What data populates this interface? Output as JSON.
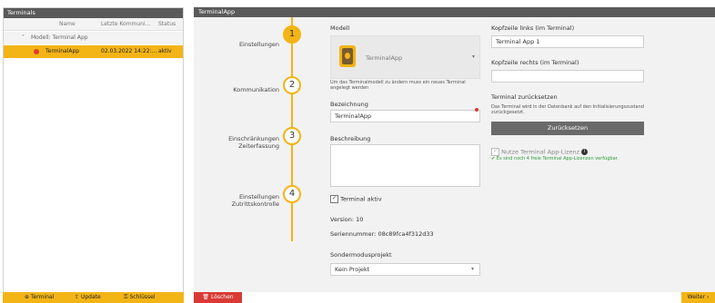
{
  "left_panel": {
    "title": "Terminals",
    "columns": {
      "name": "Name",
      "last_comm": "Letzte Kommuni...",
      "status": "Status"
    },
    "group": "Modell: Terminal App",
    "rows": [
      {
        "name": "TerminalApp",
        "last_comm": "02.03.2022 14:22:...",
        "status": "aktiv"
      }
    ]
  },
  "left_toolbar": {
    "terminal_label": "Terminal",
    "update_label": "Update",
    "key_label": "Schlüssel"
  },
  "right_panel": {
    "title": "TerminalApp",
    "steps": [
      {
        "number": "1",
        "label_line1": "Einstellungen",
        "label_line2": ""
      },
      {
        "number": "2",
        "label_line1": "Kommunikation",
        "label_line2": ""
      },
      {
        "number": "3",
        "label_line1": "Einschränkungen",
        "label_line2": "Zeiterfassung"
      },
      {
        "number": "4",
        "label_line1": "Einstellungen",
        "label_line2": "Zutrittskontrolle"
      }
    ],
    "model": {
      "label": "Modell",
      "selected": "TerminalApp",
      "hint": "Um das Terminalmodell zu ändern muss ein neues Terminal angelegt werden"
    },
    "designation": {
      "label": "Bezeichnung",
      "value": "TerminalApp"
    },
    "description": {
      "label": "Beschreibung",
      "value": ""
    },
    "active_label": "Terminal aktiv",
    "version": "Version: 10",
    "serial": "Seriennummer: 08c89fca4f312d33",
    "special_mode": {
      "label": "Sondermodusprojekt",
      "value": "Kein Projekt"
    },
    "header_left": {
      "label": "Kopfzeile links (im Terminal)",
      "value": "Terminal App 1"
    },
    "header_right": {
      "label": "Kopfzeile rechts (im Terminal)",
      "value": ""
    },
    "reset": {
      "title": "Terminal zurücksetzen",
      "desc": "Das Terminal wird in der Datenbank auf den Initialisierungszustand zurückgesetzt.",
      "button": "Zurücksetzen"
    },
    "license": {
      "label": "Nutze Terminal App-Lizenz",
      "info": "✔ Es sind noch 4 freie Terminal App-Lizenzen verfügbar."
    }
  },
  "bottom": {
    "delete_label": "Löschen",
    "next_label": "Weiter ›"
  },
  "colors": {
    "accent": "#f3b416",
    "header": "#5a5a5a",
    "danger": "#d93a35",
    "status_dot": "#e23c2a"
  }
}
